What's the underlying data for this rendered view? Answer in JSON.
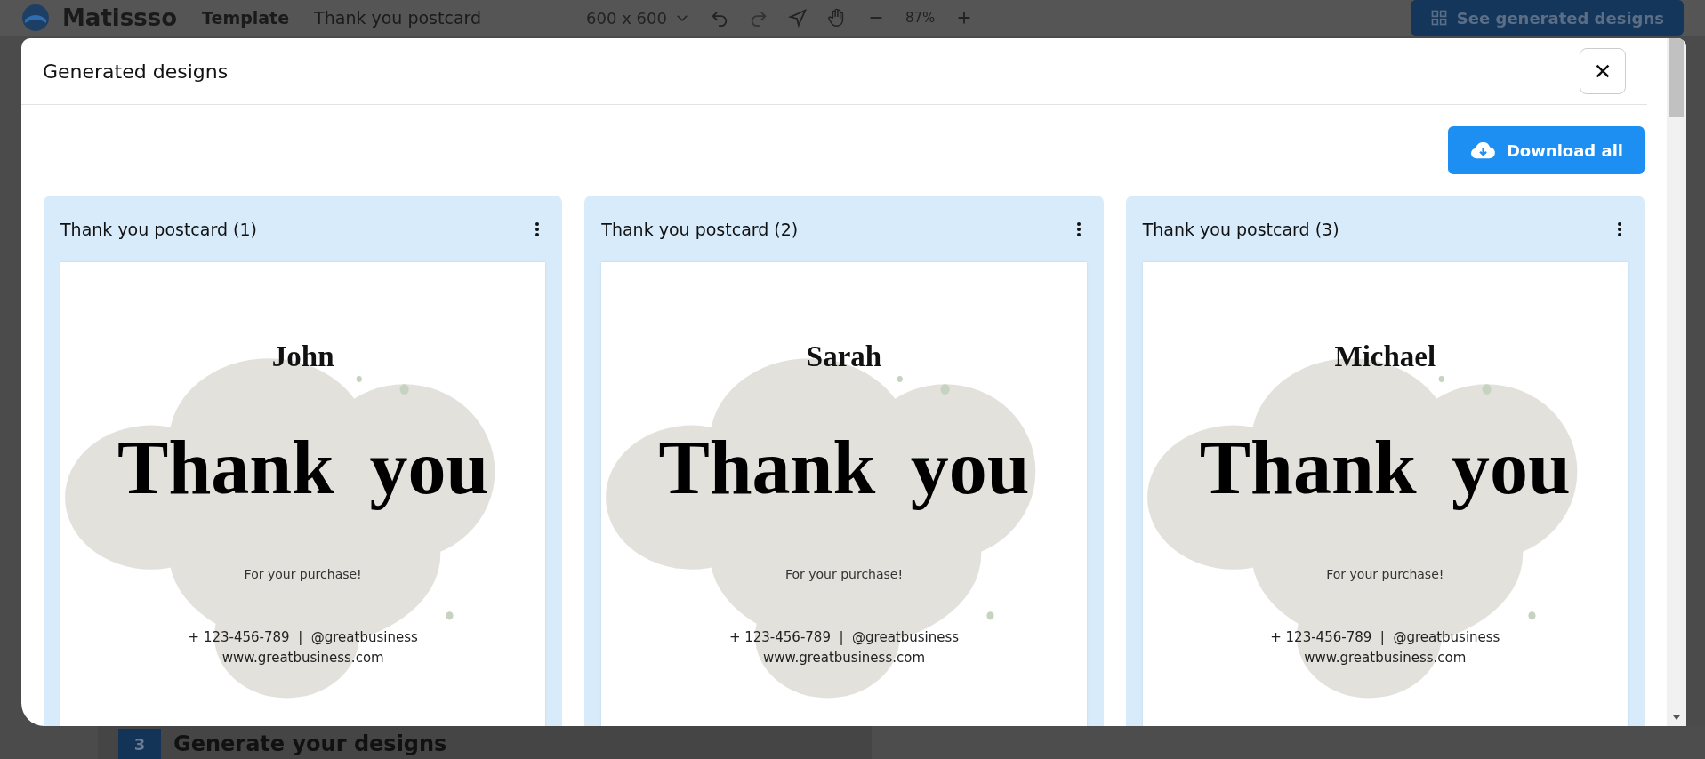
{
  "app_bar": {
    "logo": "Matissso",
    "breadcrumb": [
      "Template",
      "Thank you postcard"
    ],
    "canvas_size": "600 x 600",
    "zoom": "87%",
    "see_designs_button": "See generated designs"
  },
  "step": {
    "number": "3",
    "label": "Generate your designs"
  },
  "modal": {
    "title": "Generated designs",
    "download_button": "Download all",
    "designs": [
      {
        "title": "Thank you postcard (1)",
        "recipient": "John",
        "headline": "Thank you",
        "tagline": "For your purchase!",
        "contact": "+ 123-456-789  |  @greatbusiness",
        "website": "www.greatbusiness.com"
      },
      {
        "title": "Thank you postcard (2)",
        "recipient": "Sarah",
        "headline": "Thank you",
        "tagline": "For your purchase!",
        "contact": "+ 123-456-789  |  @greatbusiness",
        "website": "www.greatbusiness.com"
      },
      {
        "title": "Thank you postcard (3)",
        "recipient": "Michael",
        "headline": "Thank you",
        "tagline": "For your purchase!",
        "contact": "+ 123-456-789  |  @greatbusiness",
        "website": "www.greatbusiness.com"
      }
    ]
  }
}
